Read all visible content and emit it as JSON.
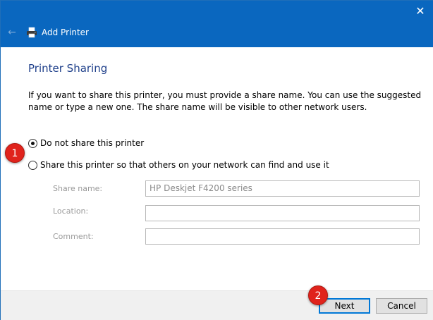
{
  "window": {
    "title": "Add Printer",
    "close_glyph": "✕",
    "back_glyph": "←",
    "title_icon": "printer-icon",
    "accent": "#0a67bf"
  },
  "page": {
    "heading": "Printer Sharing",
    "description": "If you want to share this printer, you must provide a share name. You can use the suggested name or type a new one. The share name will be visible to other network users."
  },
  "options": {
    "do_not_share": {
      "label": "Do not share this printer",
      "selected": true
    },
    "share": {
      "label": "Share this printer so that others on your network can find and use it",
      "selected": false
    }
  },
  "fields": {
    "share_name": {
      "label": "Share name:",
      "value": "HP Deskjet F4200 series"
    },
    "location": {
      "label": "Location:",
      "value": ""
    },
    "comment": {
      "label": "Comment:",
      "value": ""
    }
  },
  "buttons": {
    "next": "Next",
    "cancel": "Cancel"
  },
  "markers": {
    "first": "1",
    "second": "2",
    "color": "#e0231c"
  }
}
